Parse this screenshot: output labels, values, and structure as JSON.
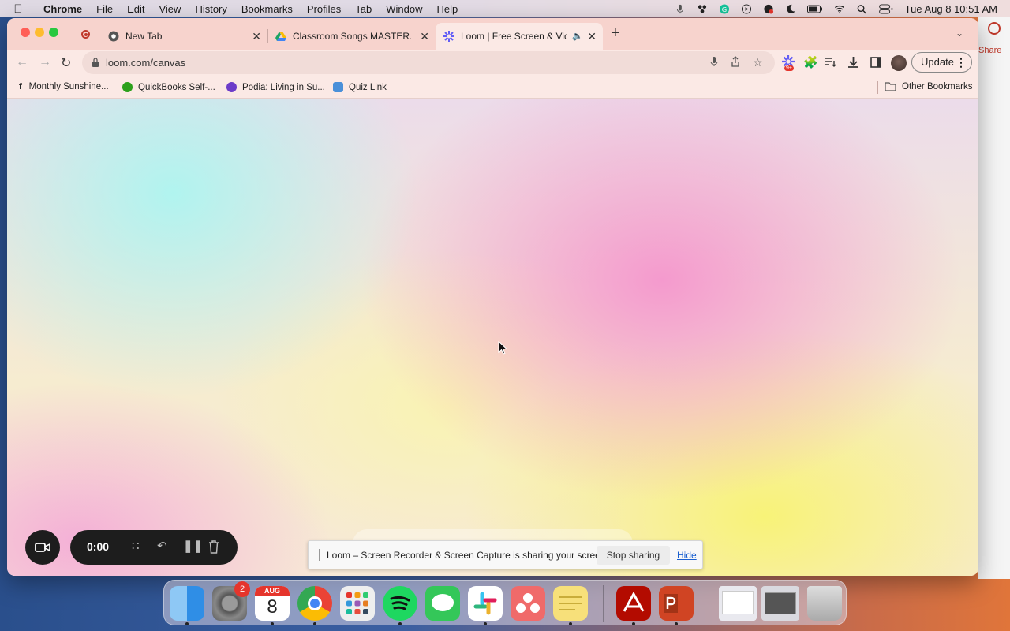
{
  "menubar": {
    "app_name": "Chrome",
    "items": [
      "File",
      "Edit",
      "View",
      "History",
      "Bookmarks",
      "Profiles",
      "Tab",
      "Window",
      "Help"
    ],
    "datetime": "Tue Aug 8  10:51 AM"
  },
  "tabs": [
    {
      "label": "New Tab",
      "close": "✕"
    },
    {
      "label": "Classroom Songs MASTER.pptx",
      "close": "✕"
    },
    {
      "label": "Loom | Free Screen & Video Recording Software",
      "close": "✕",
      "active": true
    }
  ],
  "toolbar": {
    "url": "loom.com/canvas",
    "update_label": "Update",
    "extension_badge": "9+"
  },
  "bookmarks": [
    {
      "label": "Monthly Sunshine..."
    },
    {
      "label": "QuickBooks Self-..."
    },
    {
      "label": "Podia: Living in Su..."
    },
    {
      "label": "Quiz Link"
    }
  ],
  "other_bookmarks": "Other Bookmarks",
  "loom": {
    "timer": "0:00"
  },
  "share_bar": {
    "message": "Loom – Screen Recorder & Screen Capture is sharing your screen.",
    "stop_label": "Stop sharing",
    "hide_label": "Hide"
  },
  "background_app": {
    "share_label": "Share"
  },
  "dock": {
    "settings_badge": "2",
    "calendar_month": "AUG",
    "calendar_day": "8",
    "apps": [
      "Finder",
      "System Settings",
      "Calendar",
      "Chrome",
      "Launchpad",
      "Spotify",
      "Messages",
      "Slack",
      "Asana",
      "Stickies",
      "Acrobat",
      "PowerPoint",
      "Trash"
    ]
  },
  "colors": {
    "accent": "#1a5fd0",
    "record_red": "#c0392b",
    "tab_strip": "#f7d3cd"
  }
}
